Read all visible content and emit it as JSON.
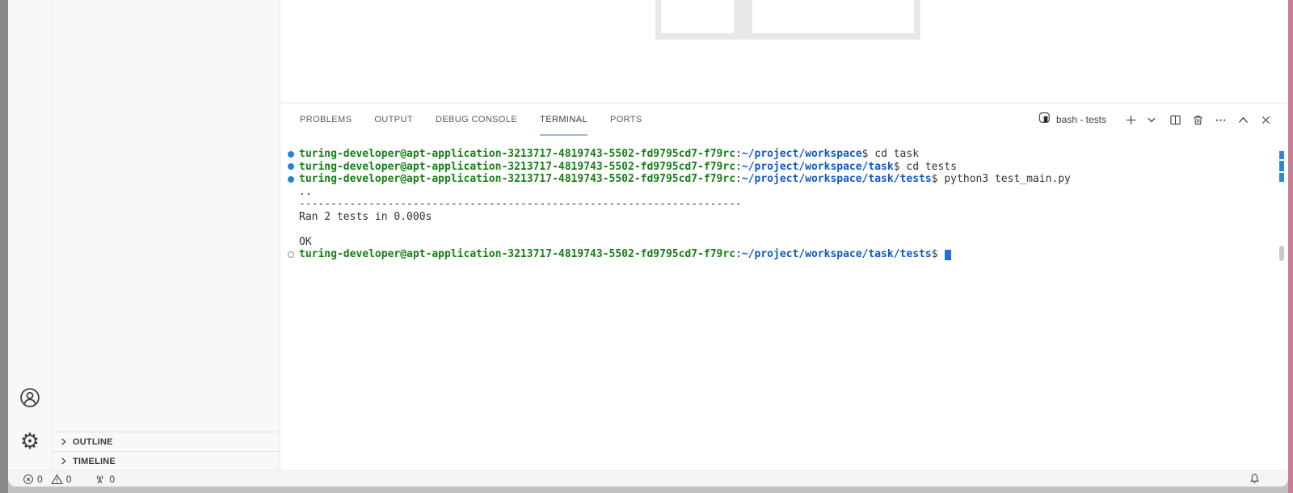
{
  "desktop": {
    "left_strip_color": "#8a8a8a",
    "right_strip_color": "#c87e97"
  },
  "activity_bar": {
    "icons": [
      "account-icon",
      "settings-gear-icon"
    ],
    "gear_glyph": "⚙"
  },
  "sidebar": {
    "sections": [
      {
        "label": "OUTLINE"
      },
      {
        "label": "TIMELINE"
      }
    ]
  },
  "editor": {
    "artifact": {
      "frame_color": "#e8e8e8",
      "cell_color": "#ffffff",
      "cells": 2
    }
  },
  "panel": {
    "tabs": [
      {
        "label": "PROBLEMS",
        "active": false
      },
      {
        "label": "OUTPUT",
        "active": false
      },
      {
        "label": "DEBUG CONSOLE",
        "active": false
      },
      {
        "label": "TERMINAL",
        "active": true
      },
      {
        "label": "PORTS",
        "active": false
      }
    ],
    "terminal": {
      "title": "bash - tests",
      "action_icons": [
        "new-terminal-icon",
        "launch-profile-chevron-icon",
        "split-terminal-icon",
        "kill-terminal-trash-icon",
        "more-actions-ellipsis-icon",
        "maximize-panel-chevron-icon",
        "close-panel-icon"
      ],
      "colors": {
        "prompt_green": "#157f15",
        "path_blue": "#1059c9",
        "foreground": "#333333",
        "cursor": "#1b74cf",
        "decoration_dot": "#2383d2",
        "active_tab_underline": "#9db6cd"
      },
      "lines": [
        {
          "decoration": "filled",
          "segments": [
            {
              "t": "turing-developer@apt-application-3213717-4819743-5502-fd9795cd7-f79rc",
              "c": "green"
            },
            {
              "t": ":",
              "c": "fg"
            },
            {
              "t": "~/project/workspace",
              "c": "blue"
            },
            {
              "t": "$ cd task",
              "c": "fg"
            }
          ]
        },
        {
          "decoration": "filled",
          "segments": [
            {
              "t": "turing-developer@apt-application-3213717-4819743-5502-fd9795cd7-f79rc",
              "c": "green"
            },
            {
              "t": ":",
              "c": "fg"
            },
            {
              "t": "~/project/workspace/task",
              "c": "blue"
            },
            {
              "t": "$ cd tests",
              "c": "fg"
            }
          ]
        },
        {
          "decoration": "filled",
          "segments": [
            {
              "t": "turing-developer@apt-application-3213717-4819743-5502-fd9795cd7-f79rc",
              "c": "green"
            },
            {
              "t": ":",
              "c": "fg"
            },
            {
              "t": "~/project/workspace/task/tests",
              "c": "blue"
            },
            {
              "t": "$ python3 test_main.py",
              "c": "fg"
            }
          ]
        },
        {
          "decoration": "",
          "segments": [
            {
              "t": "..",
              "c": "fg"
            }
          ]
        },
        {
          "decoration": "",
          "segments": [
            {
              "t": "----------------------------------------------------------------------",
              "c": "fg"
            }
          ]
        },
        {
          "decoration": "",
          "segments": [
            {
              "t": "Ran 2 tests in 0.000s",
              "c": "fg"
            }
          ]
        },
        {
          "decoration": "",
          "segments": []
        },
        {
          "decoration": "",
          "segments": [
            {
              "t": "OK",
              "c": "fg"
            }
          ]
        },
        {
          "decoration": "hollow",
          "cursor": true,
          "segments": [
            {
              "t": "turing-developer@apt-application-3213717-4819743-5502-fd9795cd7-f79rc",
              "c": "green"
            },
            {
              "t": ":",
              "c": "fg"
            },
            {
              "t": "~/project/workspace/task/tests",
              "c": "blue"
            },
            {
              "t": "$ ",
              "c": "fg"
            }
          ]
        }
      ]
    }
  },
  "status_bar": {
    "errors": "0",
    "warnings": "0",
    "ports": "0",
    "icons": [
      "errors-icon",
      "warnings-icon",
      "radio-tower-icon",
      "bell-icon"
    ]
  }
}
